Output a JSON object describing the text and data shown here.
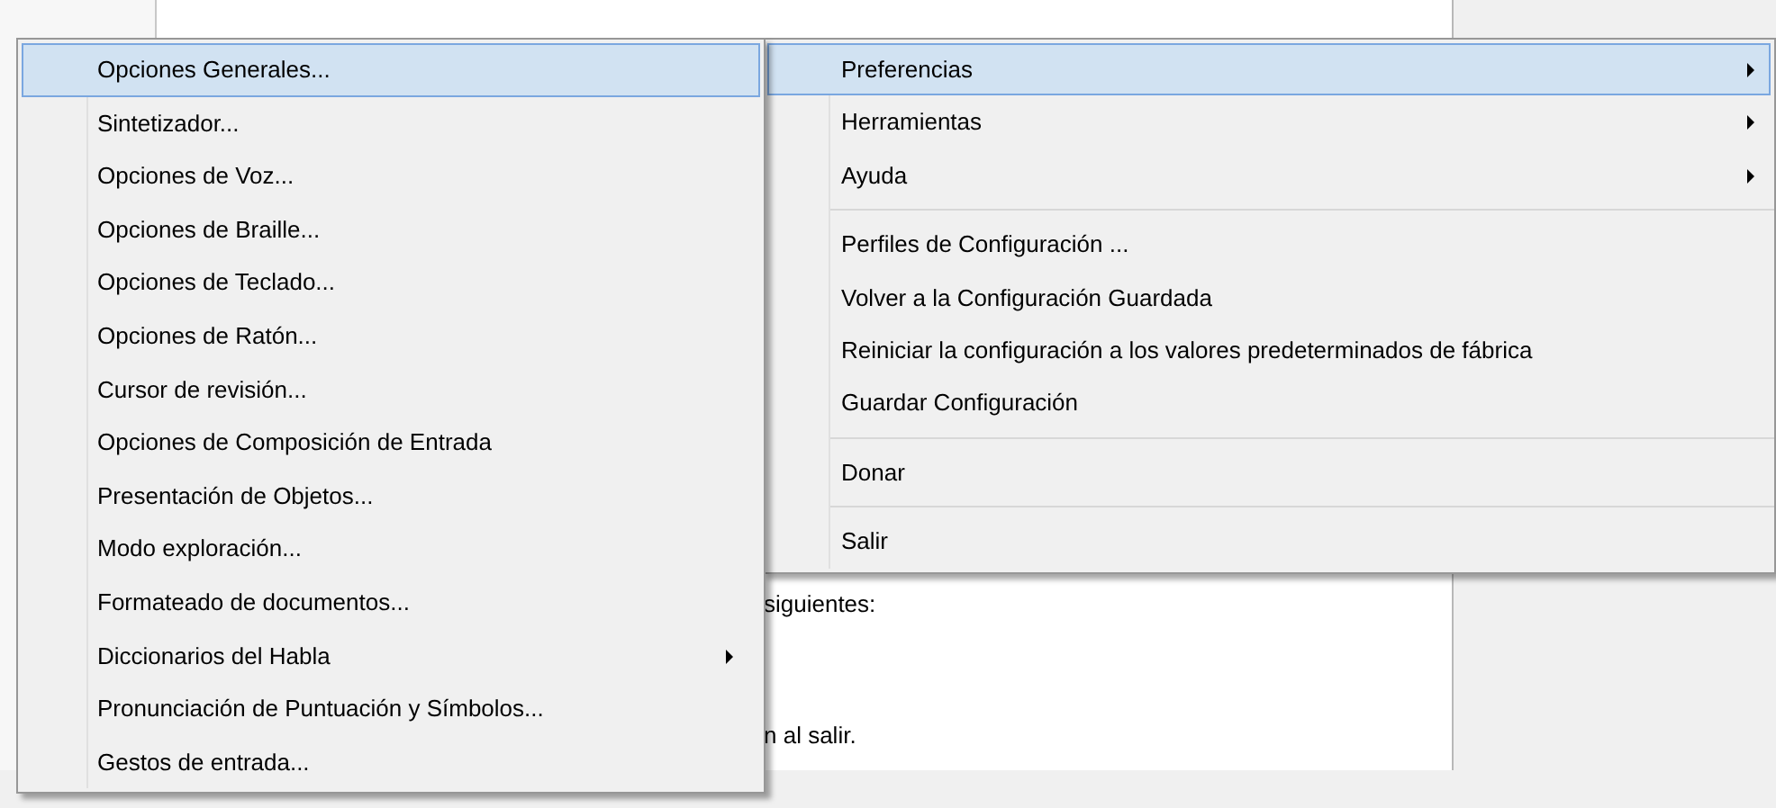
{
  "document": {
    "lines": [
      "siguientes:",
      "n al salir."
    ]
  },
  "main_menu": {
    "items": [
      {
        "kind": "item",
        "label": "Preferencias",
        "submenu": true,
        "selected": true
      },
      {
        "kind": "item",
        "label": "Herramientas",
        "submenu": true,
        "selected": false
      },
      {
        "kind": "item",
        "label": "Ayuda",
        "submenu": true,
        "selected": false
      },
      {
        "kind": "separator"
      },
      {
        "kind": "item",
        "label": "Perfiles de Configuración ...",
        "submenu": false,
        "selected": false
      },
      {
        "kind": "item",
        "label": "Volver a la Configuración Guardada",
        "submenu": false,
        "selected": false
      },
      {
        "kind": "item",
        "label": "Reiniciar la configuración a los valores predeterminados de fábrica",
        "submenu": false,
        "selected": false
      },
      {
        "kind": "item",
        "label": "Guardar Configuración",
        "submenu": false,
        "selected": false
      },
      {
        "kind": "separator"
      },
      {
        "kind": "item",
        "label": "Donar",
        "submenu": false,
        "selected": false
      },
      {
        "kind": "separator"
      },
      {
        "kind": "item",
        "label": "Salir",
        "submenu": false,
        "selected": false
      }
    ]
  },
  "preferences_submenu": {
    "items": [
      {
        "kind": "item",
        "label": "Opciones Generales...",
        "submenu": false,
        "selected": true
      },
      {
        "kind": "item",
        "label": "Sintetizador...",
        "submenu": false,
        "selected": false
      },
      {
        "kind": "item",
        "label": "Opciones de Voz...",
        "submenu": false,
        "selected": false
      },
      {
        "kind": "item",
        "label": "Opciones de Braille...",
        "submenu": false,
        "selected": false
      },
      {
        "kind": "item",
        "label": "Opciones de Teclado...",
        "submenu": false,
        "selected": false
      },
      {
        "kind": "item",
        "label": "Opciones de Ratón...",
        "submenu": false,
        "selected": false
      },
      {
        "kind": "item",
        "label": "Cursor de revisión...",
        "submenu": false,
        "selected": false
      },
      {
        "kind": "item",
        "label": "Opciones de Composición de Entrada",
        "submenu": false,
        "selected": false
      },
      {
        "kind": "item",
        "label": "Presentación de Objetos...",
        "submenu": false,
        "selected": false
      },
      {
        "kind": "item",
        "label": "Modo exploración...",
        "submenu": false,
        "selected": false
      },
      {
        "kind": "item",
        "label": "Formateado de documentos...",
        "submenu": false,
        "selected": false
      },
      {
        "kind": "item",
        "label": "Diccionarios del Habla",
        "submenu": true,
        "selected": false
      },
      {
        "kind": "item",
        "label": "Pronunciación de Puntuación y Símbolos...",
        "submenu": false,
        "selected": false
      },
      {
        "kind": "item",
        "label": "Gestos de entrada...",
        "submenu": false,
        "selected": false
      }
    ]
  }
}
